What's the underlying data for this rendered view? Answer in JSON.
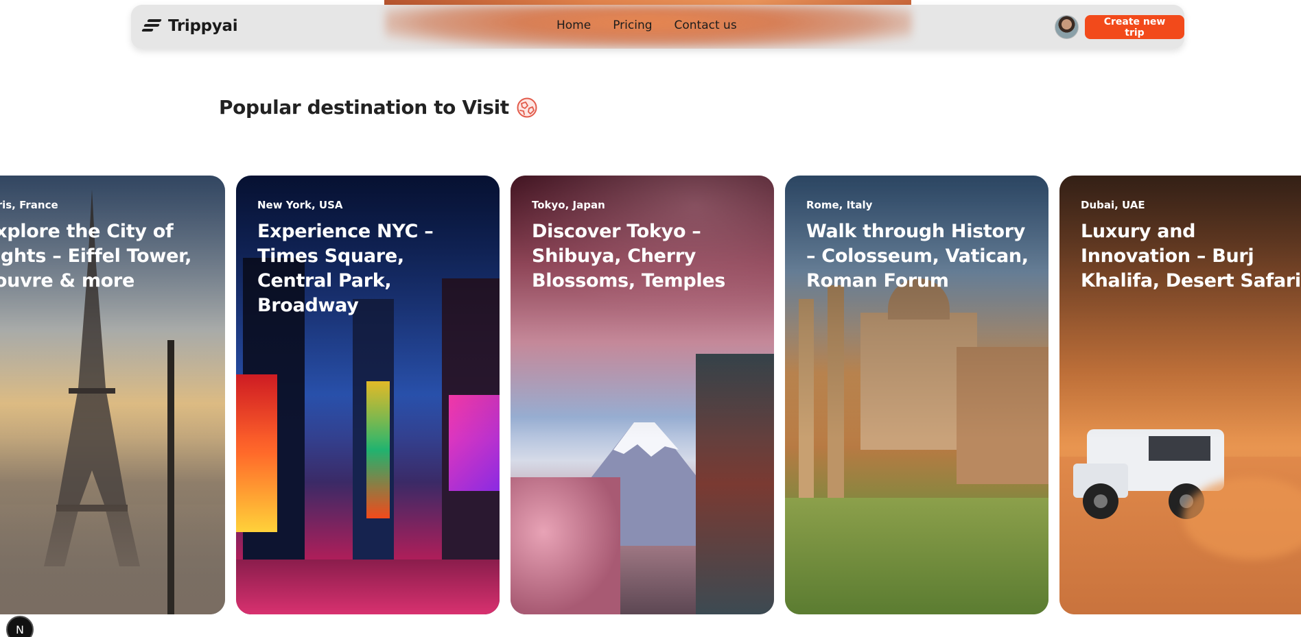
{
  "header": {
    "logo_text": "Trippyai",
    "nav": [
      "Home",
      "Pricing",
      "Contact us"
    ],
    "cta_label": "Create new trip"
  },
  "main": {
    "title": "Popular destination to Visit"
  },
  "destinations": [
    {
      "location": "Paris, France",
      "headline": "Explore the City of Lights – Eiffel Tower, Louvre & more"
    },
    {
      "location": "New York, USA",
      "headline": "Experience NYC – Times Square, Central Park, Broadway"
    },
    {
      "location": "Tokyo, Japan",
      "headline": "Discover Tokyo – Shibuya, Cherry Blossoms, Temples"
    },
    {
      "location": "Rome, Italy",
      "headline": "Walk through History – Colosseum, Vatican, Roman Forum"
    },
    {
      "location": "Dubai, UAE",
      "headline": "Luxury and Innovation – Burj Khalifa, Desert Safari"
    }
  ],
  "dev_badge": "N",
  "colors": {
    "accent": "#f24a1b",
    "nav_bg": "#e6e6e6"
  },
  "icons": {
    "logo": "logo-icon",
    "title": "globe-icon",
    "dev": "nextjs-icon"
  }
}
